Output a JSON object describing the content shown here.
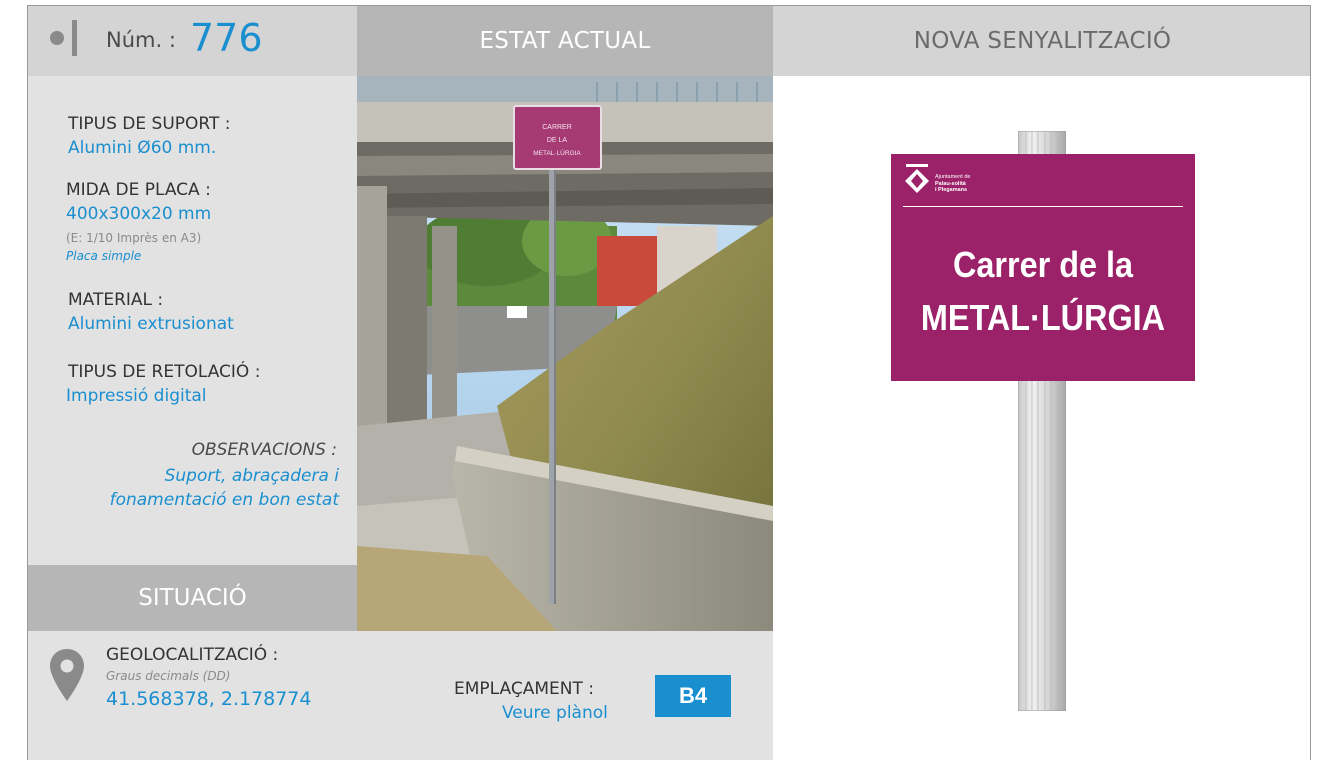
{
  "header": {
    "num_label": "Núm. :",
    "num_value": "776",
    "estat_title": "ESTAT ACTUAL",
    "nova_title": "NOVA SENYALITZACIÓ"
  },
  "info": {
    "suport_label": "TIPUS DE SUPORT :",
    "suport_value": "Alumini Ø60 mm.",
    "mida_label": "MIDA DE PLACA :",
    "mida_value": "400x300x20 mm",
    "mida_note": "(E: 1/10 Imprès en A3)",
    "mida_type": "Placa simple",
    "material_label": "MATERIAL :",
    "material_value": "Alumini extrusionat",
    "retolacio_label": "TIPUS DE RETOLACIÓ :",
    "retolacio_value": "Impressió digital",
    "observacions_label": "OBSERVACIONS :",
    "observacions_line1": "Suport, abraçadera i",
    "observacions_line2": "fonamentació en bon estat"
  },
  "situacio_title": "SITUACIÓ",
  "location": {
    "geo_label": "GEOLOCALITZACIÓ :",
    "geo_format": "Graus decimals (DD)",
    "coordinates": "41.568378, 2.178774",
    "emplacament_label": "EMPLAÇAMENT :",
    "emplacament_value": "Veure plànol",
    "map_code": "B4"
  },
  "photo_sign": {
    "line1": "CARRER",
    "line2": "DE LA",
    "line3": "METAL·LÚRGIA"
  },
  "new_sign": {
    "org_line1": "Ajuntament de",
    "org_line2": "Palau-solità",
    "org_line3": "i Plegamans",
    "street_line1": "Carrer de la",
    "street_line2": "METAL·LÚRGIA",
    "color": "#9b2168"
  },
  "colors": {
    "accent_blue": "#1a8fd0",
    "header_gray": "#d4d4d4",
    "header_dark_gray": "#b6b6b6",
    "panel_gray": "#e2e2e2"
  }
}
